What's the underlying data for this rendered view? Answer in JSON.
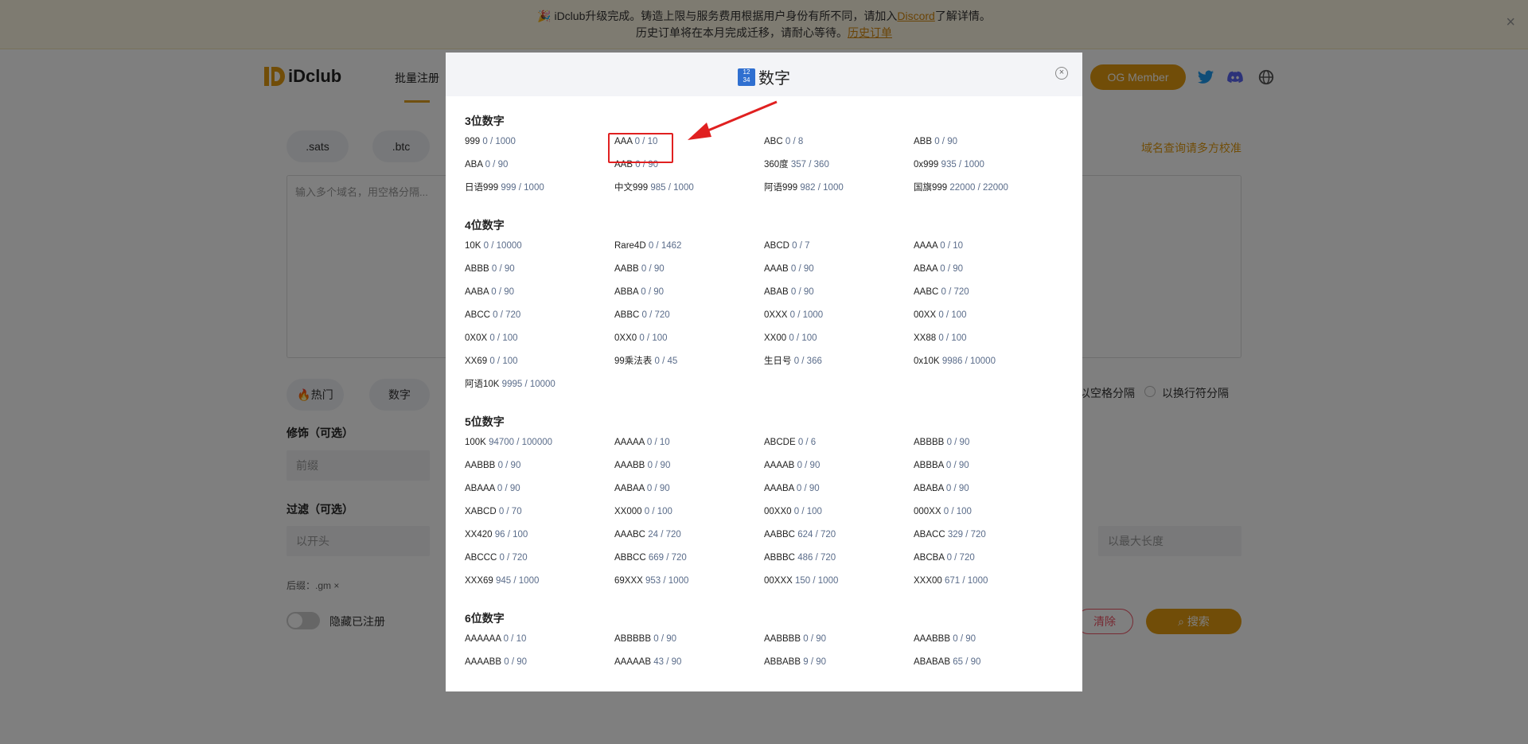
{
  "banner": {
    "line1_prefix": "🎉 iDclub升级完成。铸造上限与服务费用根据用户身份有所不同，请加入",
    "line1_link": "Discord",
    "line1_suffix": "了解详情。",
    "line2_prefix": "历史订单将在本月完成迁移，请耐心等待。",
    "line2_link": "历史订单",
    "close": "×"
  },
  "header": {
    "logo_text": "iDclub",
    "nav_item": "批量注册",
    "og_button": "OG Member"
  },
  "page": {
    "chip_sats": ".sats",
    "chip_btc": ".btc",
    "textarea_placeholder": "输入多个域名，用空格分隔...",
    "orange_link": "域名查询请多方校准",
    "chip_hot": "🔥热门",
    "chip_num": "数字",
    "radio_space": "以空格分隔",
    "radio_newline": "以换行符分隔",
    "modifier_label": "修饰（可选）",
    "prefix_placeholder": "前缀",
    "filter_label": "过滤（可选）",
    "starts_with_placeholder": "以开头",
    "max_len_placeholder": "以最大长度",
    "suffix_tag": "后缀：.gm ×",
    "hide_registered": "隐藏已注册",
    "clear_button": "清除",
    "search_button": "搜索"
  },
  "modal": {
    "title": "数字",
    "close": "×",
    "sections": [
      {
        "title": "3位数字",
        "items": [
          {
            "name": "999",
            "count": "0 / 1000"
          },
          {
            "name": "AAA",
            "count": "0 / 10"
          },
          {
            "name": "ABC",
            "count": "0 / 8"
          },
          {
            "name": "ABB",
            "count": "0 / 90"
          },
          {
            "name": "ABA",
            "count": "0 / 90"
          },
          {
            "name": "AAB",
            "count": "0 / 90"
          },
          {
            "name": "360度",
            "count": "357 / 360"
          },
          {
            "name": "0x999",
            "count": "935 / 1000"
          },
          {
            "name": "日语999",
            "count": "999 / 1000"
          },
          {
            "name": "中文999",
            "count": "985 / 1000"
          },
          {
            "name": "阿语999",
            "count": "982 / 1000"
          },
          {
            "name": "国旗999",
            "count": "22000 / 22000"
          }
        ]
      },
      {
        "title": "4位数字",
        "items": [
          {
            "name": "10K",
            "count": "0 / 10000"
          },
          {
            "name": "Rare4D",
            "count": "0 / 1462"
          },
          {
            "name": "ABCD",
            "count": "0 / 7"
          },
          {
            "name": "AAAA",
            "count": "0 / 10"
          },
          {
            "name": "ABBB",
            "count": "0 / 90"
          },
          {
            "name": "AABB",
            "count": "0 / 90"
          },
          {
            "name": "AAAB",
            "count": "0 / 90"
          },
          {
            "name": "ABAA",
            "count": "0 / 90"
          },
          {
            "name": "AABA",
            "count": "0 / 90"
          },
          {
            "name": "ABBA",
            "count": "0 / 90"
          },
          {
            "name": "ABAB",
            "count": "0 / 90"
          },
          {
            "name": "AABC",
            "count": "0 / 720"
          },
          {
            "name": "ABCC",
            "count": "0 / 720"
          },
          {
            "name": "ABBC",
            "count": "0 / 720"
          },
          {
            "name": "0XXX",
            "count": "0 / 1000"
          },
          {
            "name": "00XX",
            "count": "0 / 100"
          },
          {
            "name": "0X0X",
            "count": "0 / 100"
          },
          {
            "name": "0XX0",
            "count": "0 / 100"
          },
          {
            "name": "XX00",
            "count": "0 / 100"
          },
          {
            "name": "XX88",
            "count": "0 / 100"
          },
          {
            "name": "XX69",
            "count": "0 / 100"
          },
          {
            "name": "99乘法表",
            "count": "0 / 45"
          },
          {
            "name": "生日号",
            "count": "0 / 366"
          },
          {
            "name": "0x10K",
            "count": "9986 / 10000"
          },
          {
            "name": "阿语10K",
            "count": "9995 / 10000"
          }
        ]
      },
      {
        "title": "5位数字",
        "items": [
          {
            "name": "100K",
            "count": "94700 / 100000"
          },
          {
            "name": "AAAAA",
            "count": "0 / 10"
          },
          {
            "name": "ABCDE",
            "count": "0 / 6"
          },
          {
            "name": "ABBBB",
            "count": "0 / 90"
          },
          {
            "name": "AABBB",
            "count": "0 / 90"
          },
          {
            "name": "AAABB",
            "count": "0 / 90"
          },
          {
            "name": "AAAAB",
            "count": "0 / 90"
          },
          {
            "name": "ABBBA",
            "count": "0 / 90"
          },
          {
            "name": "ABAAA",
            "count": "0 / 90"
          },
          {
            "name": "AABAA",
            "count": "0 / 90"
          },
          {
            "name": "AAABA",
            "count": "0 / 90"
          },
          {
            "name": "ABABA",
            "count": "0 / 90"
          },
          {
            "name": "XABCD",
            "count": "0 / 70"
          },
          {
            "name": "XX000",
            "count": "0 / 100"
          },
          {
            "name": "00XX0",
            "count": "0 / 100"
          },
          {
            "name": "000XX",
            "count": "0 / 100"
          },
          {
            "name": "XX420",
            "count": "96 / 100"
          },
          {
            "name": "AAABC",
            "count": "24 / 720"
          },
          {
            "name": "AABBC",
            "count": "624 / 720"
          },
          {
            "name": "ABACC",
            "count": "329 / 720"
          },
          {
            "name": "ABCCC",
            "count": "0 / 720"
          },
          {
            "name": "ABBCC",
            "count": "669 / 720"
          },
          {
            "name": "ABBBC",
            "count": "486 / 720"
          },
          {
            "name": "ABCBA",
            "count": "0 / 720"
          },
          {
            "name": "XXX69",
            "count": "945 / 1000"
          },
          {
            "name": "69XXX",
            "count": "953 / 1000"
          },
          {
            "name": "00XXX",
            "count": "150 / 1000"
          },
          {
            "name": "XXX00",
            "count": "671 / 1000"
          }
        ]
      },
      {
        "title": "6位数字",
        "items": [
          {
            "name": "AAAAAA",
            "count": "0 / 10"
          },
          {
            "name": "ABBBBB",
            "count": "0 / 90"
          },
          {
            "name": "AABBBB",
            "count": "0 / 90"
          },
          {
            "name": "AAABBB",
            "count": "0 / 90"
          },
          {
            "name": "AAAABB",
            "count": "0 / 90"
          },
          {
            "name": "AAAAAB",
            "count": "43 / 90"
          },
          {
            "name": "ABBABB",
            "count": "9 / 90"
          },
          {
            "name": "ABABAB",
            "count": "65 / 90"
          }
        ]
      }
    ]
  },
  "colors": {
    "accent": "#e39b11",
    "count_text": "#5a6c8a",
    "highlight_box": "#e02020"
  }
}
